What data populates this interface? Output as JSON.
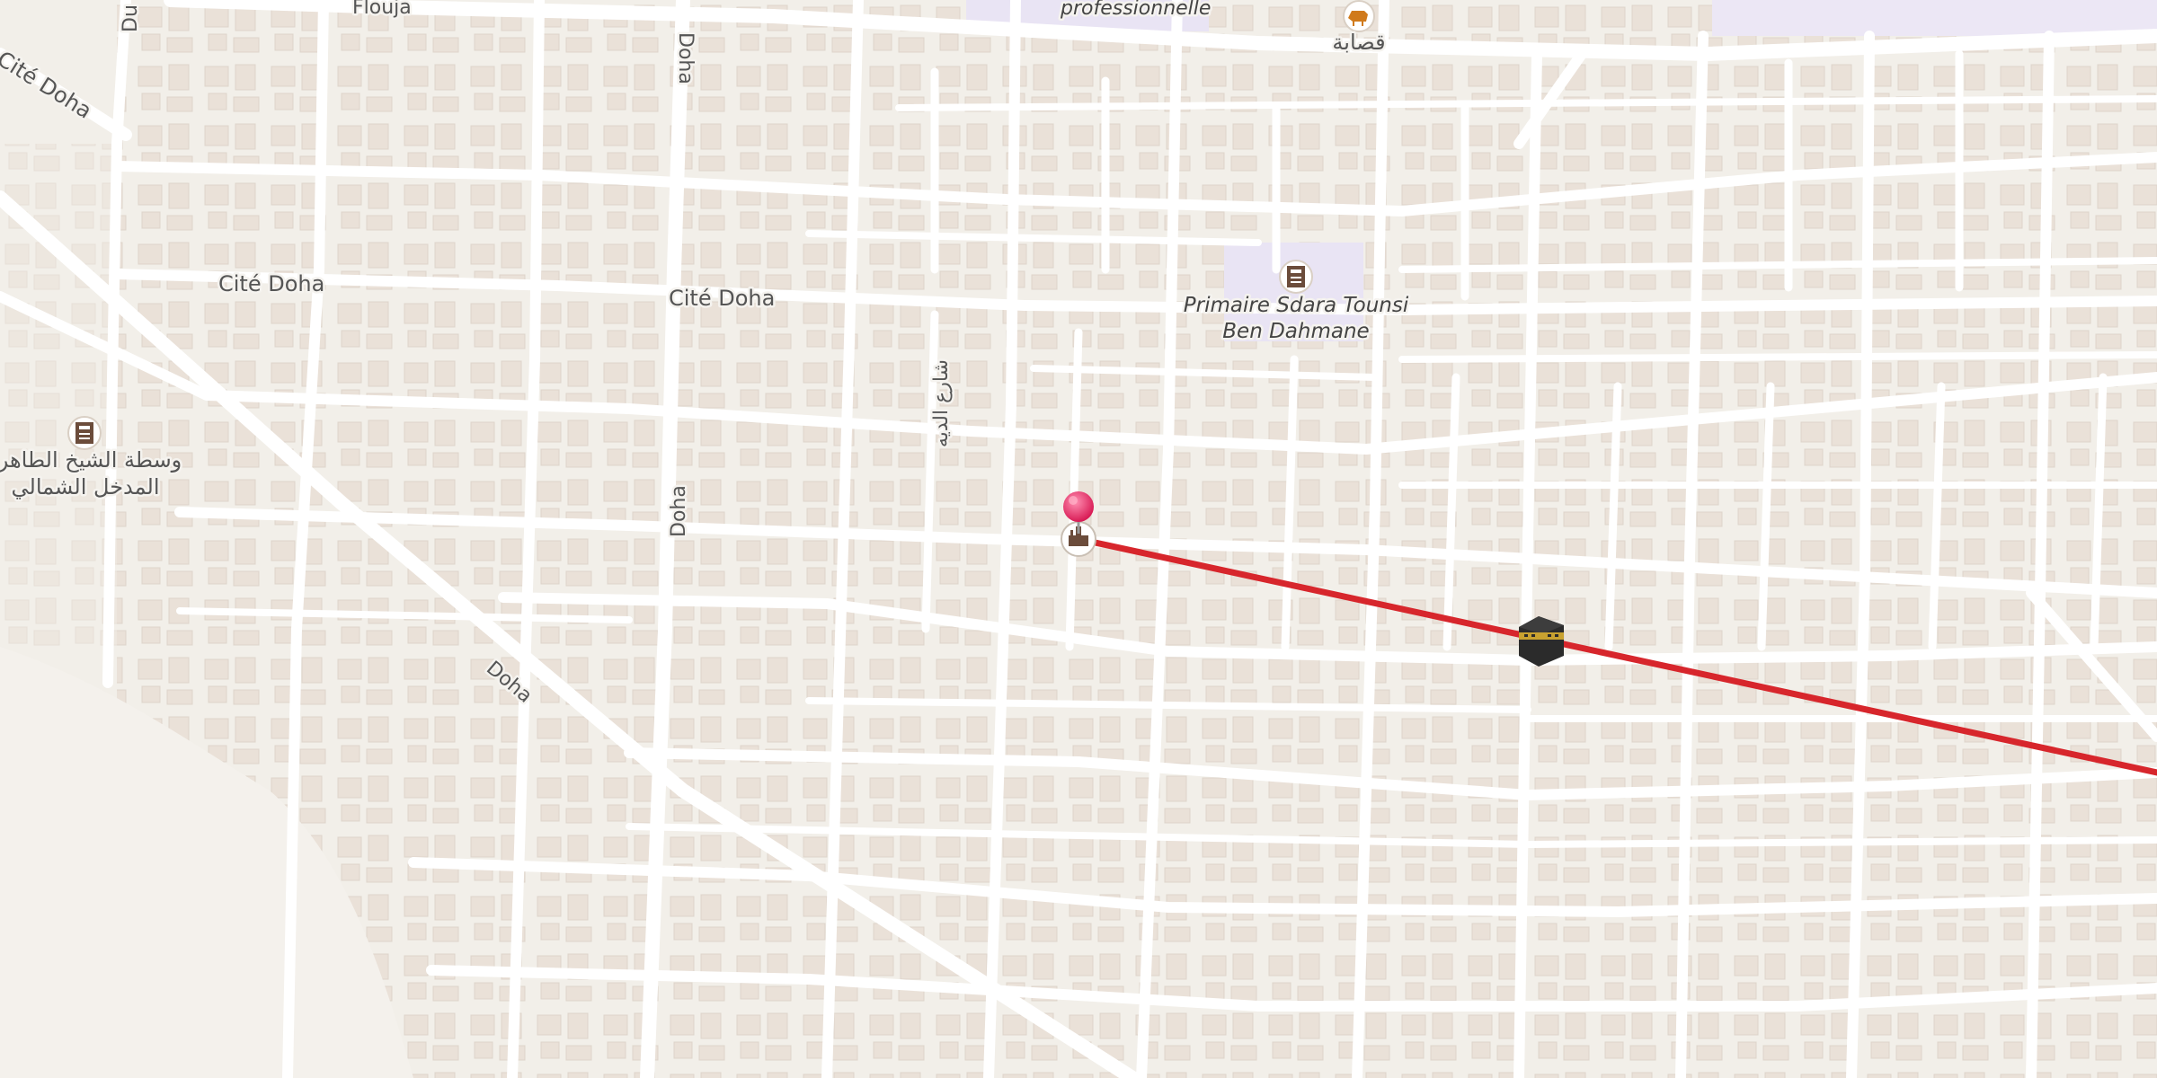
{
  "map": {
    "street_labels": {
      "flouja": "Flouja",
      "du_top": "Du",
      "cite_doha_topleft": "Cité Doha",
      "cite_doha_1": "Cité Doha",
      "cite_doha_2": "Cité Doha",
      "doha_vertical_top": "Doha",
      "doha_vertical_mid": "Doha",
      "doha_diagonal": "Doha",
      "shari_arabic": "شارع الديه"
    },
    "poi_labels": {
      "professionnelle": "professionnelle",
      "butcher_ar": "قصابة",
      "school_name_line1": "Primaire Sdara Tounsi",
      "school_name_line2": "Ben Dahmane",
      "school_ar_line1": "وسطة الشيخ الطاهر",
      "school_ar_line2": "المدخل الشمالي"
    },
    "icons": {
      "school": "school-icon",
      "butcher": "butcher-icon",
      "kaaba": "kaaba-icon",
      "pin": "map-pin-icon",
      "mosque": "mosque-icon"
    },
    "colors": {
      "background": "#f2efe9",
      "road": "#ffffff",
      "building": "#e8dfd5",
      "building_shadow": "#d9cfc4",
      "landuse": "#e9e4f4",
      "qibla_line": "#d7262c",
      "pin": "#e0245e"
    }
  }
}
